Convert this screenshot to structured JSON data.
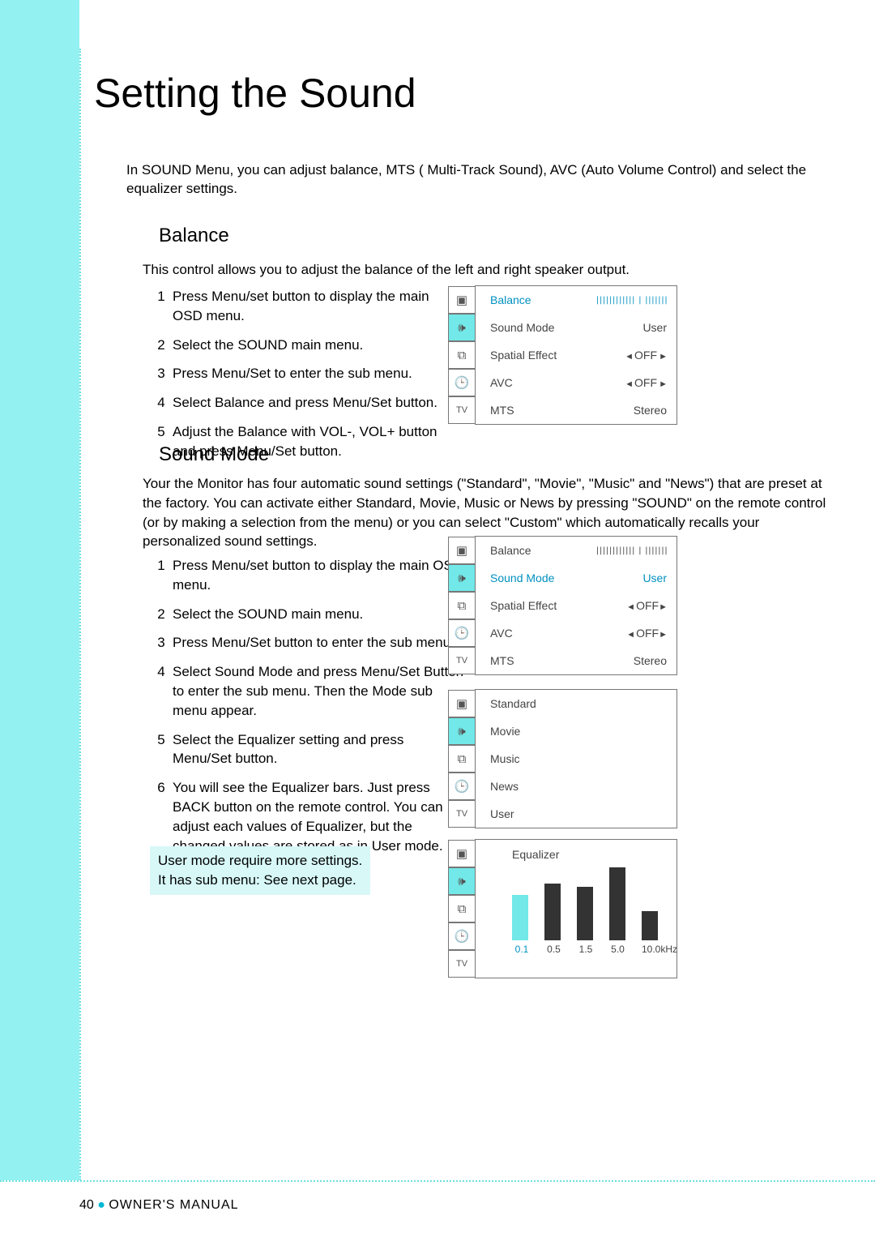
{
  "page": {
    "title": "Setting the Sound",
    "intro": "In SOUND Menu, you can adjust balance, MTS ( Multi-Track Sound), AVC (Auto Volume Control) and select the equalizer settings.",
    "footer_page": "40",
    "footer_label": "OWNER'S MANUAL"
  },
  "balance": {
    "heading": "Balance",
    "sub": "This control allows you to adjust the balance of the left and right speaker output.",
    "steps": [
      "Press Menu/set button to display the main OSD menu.",
      "Select the SOUND main menu.",
      "Press Menu/Set to enter the sub menu.",
      "Select Balance and press Menu/Set button.",
      "Adjust the Balance with VOL-, VOL+ button and press Menu/Set button."
    ]
  },
  "soundmode": {
    "heading": "Sound Mode",
    "intro": "Your the Monitor has four automatic sound settings (\"Standard\", \"Movie\", \"Music\" and \"News\") that are preset at the factory. You can activate either Standard, Movie, Music or News by pressing \"SOUND\" on the remote control (or by making a selection from the menu) or you can select \"Custom\" which automatically recalls your personalized sound settings.",
    "steps": [
      "Press Menu/set button to display the main OSD menu.",
      "Select the SOUND main menu.",
      "Press Menu/Set button to enter the sub menu.",
      "Select Sound Mode and press Menu/Set Button to enter the sub menu. Then the Mode sub menu appear.",
      "Select the Equalizer setting and press Menu/Set button.",
      "You will see the Equalizer bars. Just press BACK button on the remote control. You can adjust each values of Equalizer, but the changed values are stored as in User mode."
    ],
    "note_l1": "User mode require more settings.",
    "note_l2": "It has sub menu: See next page."
  },
  "osd": {
    "icons": [
      "picture-icon",
      "sound-icon",
      "pip-icon",
      "timer-icon",
      "tv-icon"
    ],
    "rows_main": [
      {
        "label": "Balance",
        "value": "|||||||||||| | |||||||",
        "type": "ticks"
      },
      {
        "label": "Sound Mode",
        "value": "User",
        "type": "text"
      },
      {
        "label": "Spatial Effect",
        "value": "OFF",
        "type": "arrows"
      },
      {
        "label": "AVC",
        "value": "OFF",
        "type": "arrows"
      },
      {
        "label": "MTS",
        "value": "Stereo",
        "type": "text"
      }
    ],
    "highlight1": 0,
    "highlight2": 1,
    "modes": [
      "Standard",
      "Movie",
      "Music",
      "News",
      "User"
    ],
    "eq": {
      "title": "Equalizer",
      "labels": [
        "0.1",
        "0.5",
        "1.5",
        "5.0",
        "10.0kHz"
      ]
    }
  },
  "chart_data": {
    "type": "bar",
    "title": "Equalizer",
    "categories": [
      "0.1",
      "0.5",
      "1.5",
      "5.0",
      "10.0kHz"
    ],
    "xlabel": "",
    "ylabel": "",
    "values": [
      56,
      70,
      66,
      90,
      36
    ]
  }
}
